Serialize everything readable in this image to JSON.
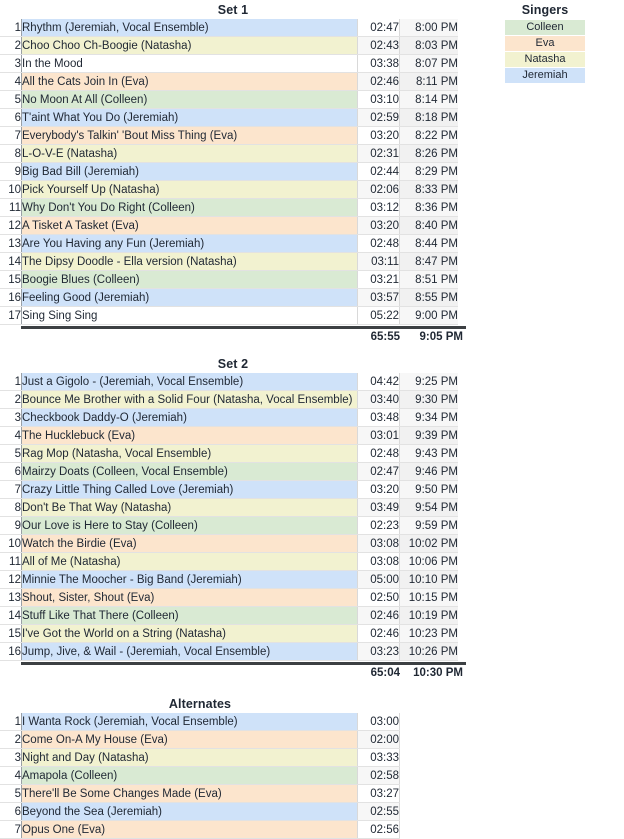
{
  "legend": {
    "title": "Singers",
    "items": [
      {
        "name": "Colleen",
        "color": "#d9ead3",
        "key": "colleen"
      },
      {
        "name": "Eva",
        "color": "#fce5cd",
        "key": "eva"
      },
      {
        "name": "Natasha",
        "color": "#f2f2d0",
        "key": "natasha"
      },
      {
        "name": "Jeremiah",
        "color": "#cfe2f9",
        "key": "jeremiah"
      }
    ]
  },
  "sets": [
    {
      "title": "Set 1",
      "has_clock": true,
      "rows": [
        {
          "num": "1",
          "title": "Rhythm (Jeremiah, Vocal Ensemble)",
          "dur": "02:47",
          "clock": "8:00 PM",
          "singer": "jeremiah"
        },
        {
          "num": "2",
          "title": "Choo Choo Ch-Boogie (Natasha)",
          "dur": "02:43",
          "clock": "8:03 PM",
          "singer": "natasha"
        },
        {
          "num": "3",
          "title": "In the Mood",
          "dur": "03:38",
          "clock": "8:07 PM",
          "singer": "none"
        },
        {
          "num": "4",
          "title": "All the Cats Join In (Eva)",
          "dur": "02:46",
          "clock": "8:11 PM",
          "singer": "eva"
        },
        {
          "num": "5",
          "title": "No Moon At All (Colleen)",
          "dur": "03:10",
          "clock": "8:14 PM",
          "singer": "colleen"
        },
        {
          "num": "6",
          "title": "T'aint What You Do (Jeremiah)",
          "dur": "02:59",
          "clock": "8:18 PM",
          "singer": "jeremiah"
        },
        {
          "num": "7",
          "title": "Everybody's Talkin' 'Bout Miss Thing (Eva)",
          "dur": "03:20",
          "clock": "8:22 PM",
          "singer": "eva"
        },
        {
          "num": "8",
          "title": "L-O-V-E (Natasha)",
          "dur": "02:31",
          "clock": "8:26 PM",
          "singer": "natasha"
        },
        {
          "num": "9",
          "title": "Big Bad Bill (Jeremiah)",
          "dur": "02:44",
          "clock": "8:29 PM",
          "singer": "jeremiah"
        },
        {
          "num": "10",
          "title": "Pick Yourself Up (Natasha)",
          "dur": "02:06",
          "clock": "8:33 PM",
          "singer": "natasha"
        },
        {
          "num": "11",
          "title": "Why Don't You Do Right (Colleen)",
          "dur": "03:12",
          "clock": "8:36 PM",
          "singer": "colleen"
        },
        {
          "num": "12",
          "title": "A Tisket A Tasket (Eva)",
          "dur": "03:20",
          "clock": "8:40 PM",
          "singer": "eva"
        },
        {
          "num": "13",
          "title": "Are You Having any Fun (Jeremiah)",
          "dur": "02:48",
          "clock": "8:44 PM",
          "singer": "jeremiah"
        },
        {
          "num": "14",
          "title": "The Dipsy Doodle - Ella version (Natasha)",
          "dur": "03:11",
          "clock": "8:47 PM",
          "singer": "natasha"
        },
        {
          "num": "15",
          "title": "Boogie Blues (Colleen)",
          "dur": "03:21",
          "clock": "8:51 PM",
          "singer": "colleen"
        },
        {
          "num": "16",
          "title": "Feeling Good (Jeremiah)",
          "dur": "03:57",
          "clock": "8:55 PM",
          "singer": "jeremiah"
        },
        {
          "num": "17",
          "title": "Sing Sing Sing",
          "dur": "05:22",
          "clock": "9:00 PM",
          "singer": "none"
        }
      ],
      "totals": {
        "dur": "65:55",
        "clock": "9:05 PM"
      }
    },
    {
      "title": "Set 2",
      "has_clock": true,
      "rows": [
        {
          "num": "1",
          "title": "Just a Gigolo - (Jeremiah, Vocal Ensemble)",
          "dur": "04:42",
          "clock": "9:25 PM",
          "singer": "jeremiah"
        },
        {
          "num": "2",
          "title": "Bounce Me Brother with a Solid Four (Natasha, Vocal Ensemble)",
          "dur": "03:40",
          "clock": "9:30 PM",
          "singer": "natasha"
        },
        {
          "num": "3",
          "title": "Checkbook Daddy-O (Jeremiah)",
          "dur": "03:48",
          "clock": "9:34 PM",
          "singer": "jeremiah"
        },
        {
          "num": "4",
          "title": "The Hucklebuck (Eva)",
          "dur": "03:01",
          "clock": "9:39 PM",
          "singer": "eva"
        },
        {
          "num": "5",
          "title": "Rag Mop (Natasha, Vocal Ensemble)",
          "dur": "02:48",
          "clock": "9:43 PM",
          "singer": "natasha"
        },
        {
          "num": "6",
          "title": "Mairzy Doats (Colleen, Vocal Ensemble)",
          "dur": "02:47",
          "clock": "9:46 PM",
          "singer": "colleen"
        },
        {
          "num": "7",
          "title": "Crazy Little Thing Called Love (Jeremiah)",
          "dur": "03:20",
          "clock": "9:50 PM",
          "singer": "jeremiah"
        },
        {
          "num": "8",
          "title": "Don't Be That Way (Natasha)",
          "dur": "03:49",
          "clock": "9:54 PM",
          "singer": "natasha"
        },
        {
          "num": "9",
          "title": "Our Love is Here to Stay (Colleen)",
          "dur": "02:23",
          "clock": "9:59 PM",
          "singer": "colleen"
        },
        {
          "num": "10",
          "title": "Watch the Birdie (Eva)",
          "dur": "03:08",
          "clock": "10:02 PM",
          "singer": "eva"
        },
        {
          "num": "11",
          "title": "All of Me (Natasha)",
          "dur": "03:08",
          "clock": "10:06 PM",
          "singer": "natasha"
        },
        {
          "num": "12",
          "title": "Minnie The Moocher - Big Band (Jeremiah)",
          "dur": "05:00",
          "clock": "10:10 PM",
          "singer": "jeremiah"
        },
        {
          "num": "13",
          "title": "Shout, Sister, Shout (Eva)",
          "dur": "02:50",
          "clock": "10:15 PM",
          "singer": "eva"
        },
        {
          "num": "14",
          "title": "Stuff Like That There (Colleen)",
          "dur": "02:46",
          "clock": "10:19 PM",
          "singer": "colleen"
        },
        {
          "num": "15",
          "title": "I've Got the World on a String (Natasha)",
          "dur": "02:46",
          "clock": "10:23 PM",
          "singer": "natasha"
        },
        {
          "num": "16",
          "title": "Jump, Jive, & Wail - (Jeremiah, Vocal Ensemble)",
          "dur": "03:23",
          "clock": "10:26 PM",
          "singer": "jeremiah"
        }
      ],
      "totals": {
        "dur": "65:04",
        "clock": "10:30 PM"
      }
    },
    {
      "title": "Alternates",
      "has_clock": false,
      "rows": [
        {
          "num": "1",
          "title": "I Wanta Rock (Jeremiah, Vocal Ensemble)",
          "dur": "03:00",
          "clock": "",
          "singer": "jeremiah"
        },
        {
          "num": "2",
          "title": "Come On-A My House (Eva)",
          "dur": "02:00",
          "clock": "",
          "singer": "eva"
        },
        {
          "num": "3",
          "title": "Night and Day (Natasha)",
          "dur": "03:33",
          "clock": "",
          "singer": "natasha"
        },
        {
          "num": "4",
          "title": "Amapola (Colleen)",
          "dur": "02:58",
          "clock": "",
          "singer": "colleen"
        },
        {
          "num": "5",
          "title": "There'll Be Some Changes Made (Eva)",
          "dur": "03:27",
          "clock": "",
          "singer": "eva"
        },
        {
          "num": "6",
          "title": "Beyond the Sea (Jeremiah)",
          "dur": "02:55",
          "clock": "",
          "singer": "jeremiah"
        },
        {
          "num": "7",
          "title": "Opus One (Eva)",
          "dur": "02:56",
          "clock": "",
          "singer": "eva"
        }
      ],
      "totals": null
    }
  ]
}
